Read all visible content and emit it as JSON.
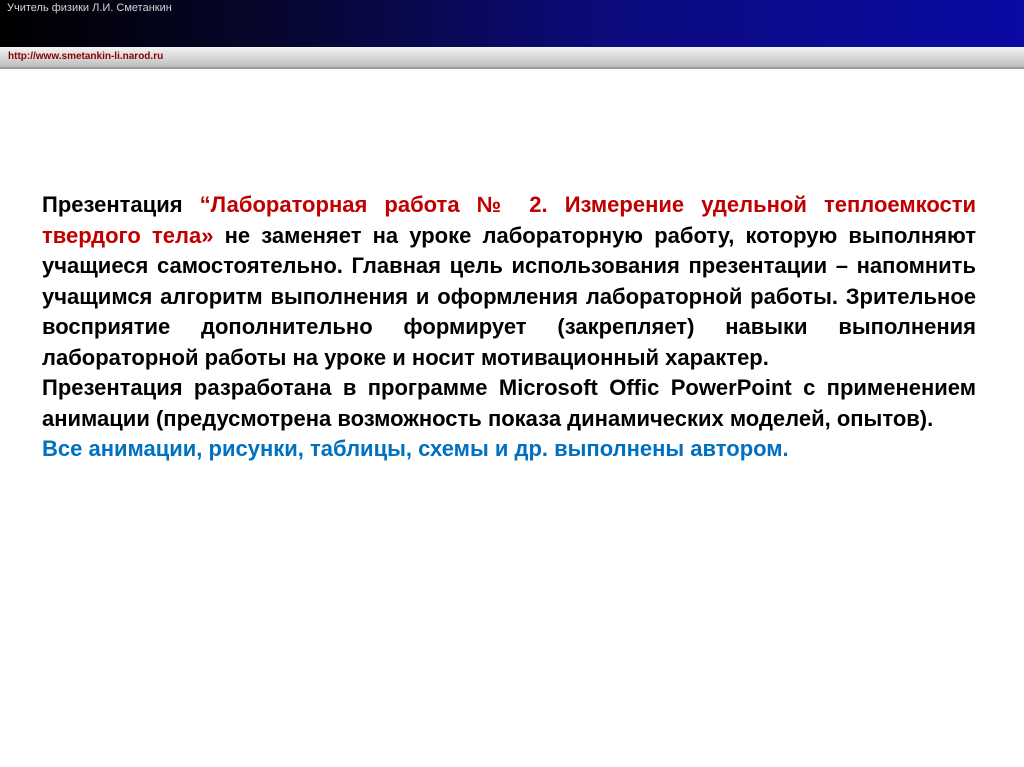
{
  "header": {
    "author_caption": "Учитель физики Л.И. Сметанкин",
    "url": "http://www.smetankin-li.narod.ru"
  },
  "colors": {
    "header_gradient": [
      "#000000",
      "#0a0aa4"
    ],
    "body_text": "#000000",
    "title_quote": "#c00000",
    "author_note": "#0070c0",
    "url_text": "#8b0000"
  },
  "content": {
    "p1_lead": "Презентация ",
    "p1_title": "“Лабораторная работа № 2. Измерение удельной теплоемкости твердого тела»",
    "p1_rest": " не заменяет на уроке лабораторную работу, которую выполняют учащиеся самостоятельно. Главная цель использования презентации – напомнить учащимся алгоритм выполнения и оформления лабораторной работы. Зрительное восприятие дополнительно формирует (закрепляет) навыки выполнения лабораторной работы на уроке и носит мотивационный характер.",
    "p2": "Презентация разработана в программе Microsoft Offic PowerPoint с применением анимации (предусмотрена возможность показа динамических моделей, опытов).",
    "p3": "Все анимации, рисунки, таблицы, схемы и др. выполнены автором."
  }
}
